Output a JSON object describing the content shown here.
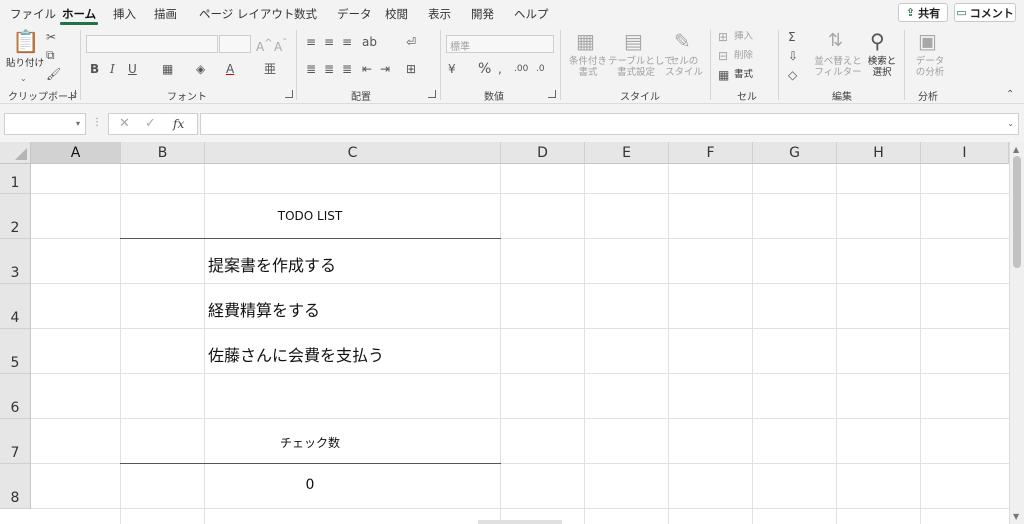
{
  "tabs": [
    "ファイル",
    "ホーム",
    "挿入",
    "描画",
    "ページ レイアウト",
    "数式",
    "データ",
    "校閲",
    "表示",
    "開発",
    "ヘルプ"
  ],
  "active_tab": "ホーム",
  "share_label": "共有",
  "comment_label": "コメント",
  "ribbon": {
    "clipboard": {
      "paste": "貼り付け",
      "label": "クリップボード"
    },
    "font": {
      "bold": "B",
      "italic": "I",
      "underline": "U",
      "label": "フォント"
    },
    "alignment": {
      "label": "配置"
    },
    "number": {
      "format": "標準",
      "percent": "%",
      "label": "数値"
    },
    "styles": {
      "conditional": [
        "条件付き",
        "書式"
      ],
      "table": [
        "テーブルとして",
        "書式設定"
      ],
      "cell": [
        "セルの",
        "スタイル"
      ],
      "label": "スタイル"
    },
    "cells": {
      "insert": "挿入",
      "delete": "削除",
      "format": "書式",
      "label": "セル"
    },
    "editing": {
      "sort": [
        "並べ替えと",
        "フィルター"
      ],
      "find": [
        "検索と",
        "選択"
      ],
      "label": "編集"
    },
    "analysis": {
      "data": [
        "データ",
        "の分析"
      ],
      "label": "分析"
    }
  },
  "formula_bar": {
    "name_box": "",
    "fx": "fx",
    "value": ""
  },
  "columns": [
    "A",
    "B",
    "C",
    "D",
    "E",
    "F",
    "G",
    "H",
    "I"
  ],
  "selected_column": "A",
  "rows": [
    "1",
    "2",
    "3",
    "4",
    "5",
    "6",
    "7",
    "8"
  ],
  "cells": {
    "C2": "TODO LIST",
    "C3": "提案書を作成する",
    "C4": "経費精算をする",
    "C5": "佐藤さんに会費を支払う",
    "C7": "チェック数",
    "C8": "0"
  }
}
